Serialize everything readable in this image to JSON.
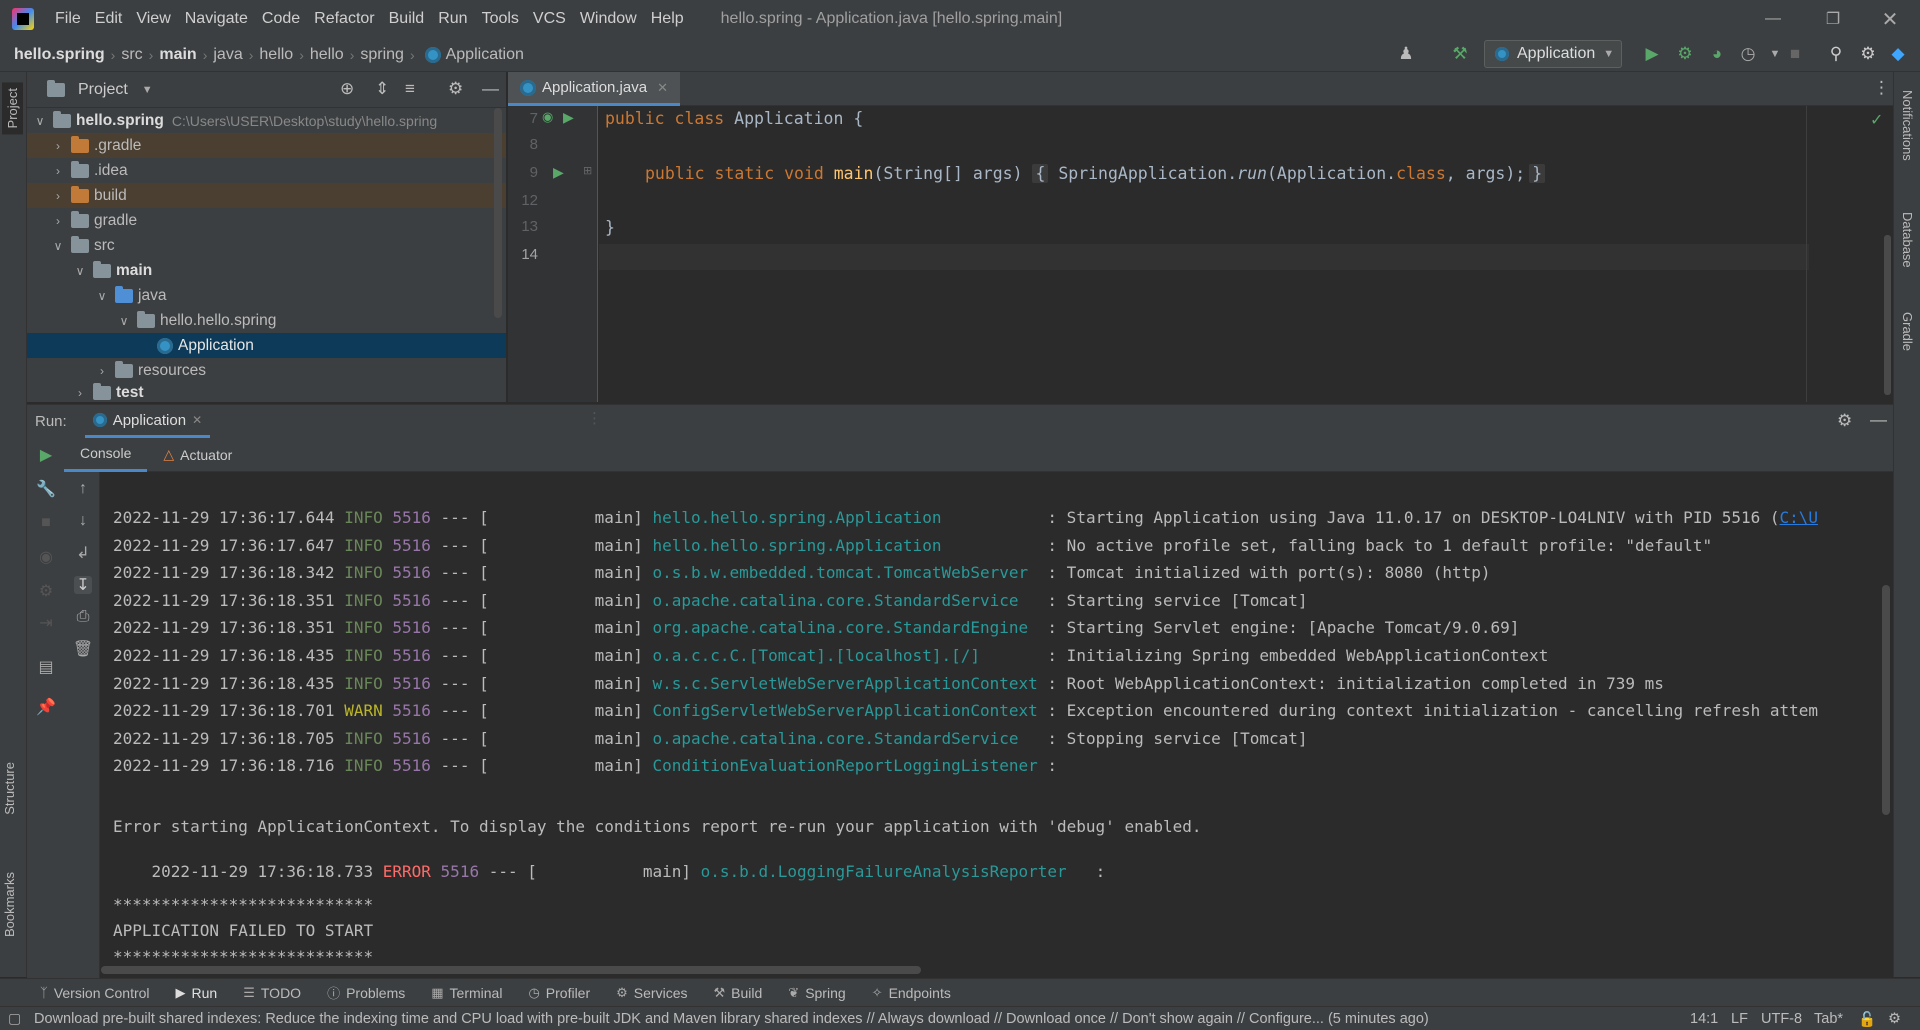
{
  "menubar": {
    "items": [
      "File",
      "Edit",
      "View",
      "Navigate",
      "Code",
      "Refactor",
      "Build",
      "Run",
      "Tools",
      "VCS",
      "Window",
      "Help"
    ],
    "title": "hello.spring - Application.java [hello.spring.main]"
  },
  "breadcrumb": [
    "hello.spring",
    "src",
    "main",
    "java",
    "hello",
    "hello",
    "spring",
    "Application"
  ],
  "toolbar": {
    "run_config": "Application"
  },
  "project": {
    "title": "Project",
    "root_label": "hello.spring",
    "root_path": "C:\\Users\\USER\\Desktop\\study\\hello.spring",
    "items": [
      ".gradle",
      ".idea",
      "build",
      "gradle",
      "src",
      "main",
      "java",
      "hello.hello.spring",
      "Application",
      "resources",
      "test"
    ]
  },
  "editor": {
    "tab": "Application.java",
    "line_numbers": [
      "7",
      "8",
      "9",
      "12",
      "13",
      "14"
    ],
    "lines": {
      "l7_kw": "public class ",
      "l7_name": "Application {",
      "l9_kw1": "public static void ",
      "l9_fn": "main",
      "l9_args": "(String[] args) ",
      "l9_fold_open": "{",
      "l9_body1": " SpringApplication.",
      "l9_run": "run",
      "l9_body2": "(Application.",
      "l9_class": "class",
      "l9_body3": ", args);",
      "l9_fold_close": "}",
      "l13": "}"
    }
  },
  "run": {
    "label": "Run:",
    "tab": "Application",
    "subtabs": [
      "Console",
      "Actuator"
    ]
  },
  "console": {
    "logs": [
      {
        "ts": "2022-11-29 17:36:17.644",
        "level": "INFO",
        "pid": "5516",
        "thread": "--- [           main] ",
        "logger": "hello.hello.spring.Application          ",
        "msg": " : Starting Application using Java 11.0.17 on DESKTOP-LO4LNIV with PID 5516 (",
        "link": "C:\\U"
      },
      {
        "ts": "2022-11-29 17:36:17.647",
        "level": "INFO",
        "pid": "5516",
        "thread": "--- [           main] ",
        "logger": "hello.hello.spring.Application          ",
        "msg": " : No active profile set, falling back to 1 default profile: \"default\""
      },
      {
        "ts": "2022-11-29 17:36:18.342",
        "level": "INFO",
        "pid": "5516",
        "thread": "--- [           main] ",
        "logger": "o.s.b.w.embedded.tomcat.TomcatWebServer ",
        "msg": " : Tomcat initialized with port(s): 8080 (http)"
      },
      {
        "ts": "2022-11-29 17:36:18.351",
        "level": "INFO",
        "pid": "5516",
        "thread": "--- [           main] ",
        "logger": "o.apache.catalina.core.StandardService  ",
        "msg": " : Starting service [Tomcat]"
      },
      {
        "ts": "2022-11-29 17:36:18.351",
        "level": "INFO",
        "pid": "5516",
        "thread": "--- [           main] ",
        "logger": "org.apache.catalina.core.StandardEngine ",
        "msg": " : Starting Servlet engine: [Apache Tomcat/9.0.69]"
      },
      {
        "ts": "2022-11-29 17:36:18.435",
        "level": "INFO",
        "pid": "5516",
        "thread": "--- [           main] ",
        "logger": "o.a.c.c.C.[Tomcat].[localhost].[/]      ",
        "msg": " : Initializing Spring embedded WebApplicationContext"
      },
      {
        "ts": "2022-11-29 17:36:18.435",
        "level": "INFO",
        "pid": "5516",
        "thread": "--- [           main] ",
        "logger": "w.s.c.ServletWebServerApplicationContext",
        "msg": " : Root WebApplicationContext: initialization completed in 739 ms"
      },
      {
        "ts": "2022-11-29 17:36:18.701",
        "level": "WARN",
        "pid": "5516",
        "thread": "--- [           main] ",
        "logger": "ConfigServletWebServerApplicationContext",
        "msg": " : Exception encountered during context initialization - cancelling refresh attem"
      },
      {
        "ts": "2022-11-29 17:36:18.705",
        "level": "INFO",
        "pid": "5516",
        "thread": "--- [           main] ",
        "logger": "o.apache.catalina.core.StandardService  ",
        "msg": " : Stopping service [Tomcat]"
      },
      {
        "ts": "2022-11-29 17:36:18.716",
        "level": "INFO",
        "pid": "5516",
        "thread": "--- [           main] ",
        "logger": "ConditionEvaluationReportLoggingListener",
        "msg": " :"
      }
    ],
    "error_context": "Error starting ApplicationContext. To display the conditions report re-run your application with 'debug' enabled.",
    "error_log": {
      "ts": "2022-11-29 17:36:18.733",
      "level": "ERROR",
      "pid": "5516",
      "thread": "--- [           main] ",
      "logger": "o.s.b.d.LoggingFailureAnalysisReporter  ",
      "msg": " :"
    },
    "stars": "***************************",
    "failed": "APPLICATION FAILED TO START",
    "stars2": "***************************"
  },
  "left_strip": {
    "project": "Project",
    "structure": "Structure",
    "bookmarks": "Bookmarks"
  },
  "right_strip": {
    "notifications": "Notifications",
    "database": "Database",
    "gradle": "Gradle"
  },
  "bottom_tabs": [
    "Version Control",
    "Run",
    "TODO",
    "Problems",
    "Terminal",
    "Profiler",
    "Services",
    "Build",
    "Spring",
    "Endpoints"
  ],
  "status": {
    "message": "Download pre-built shared indexes: Reduce the indexing time and CPU load with pre-built JDK and Maven library shared indexes // Always download // Download once // Don't show again // Configure... (5 minutes ago)",
    "position": "14:1",
    "line_sep": "LF",
    "encoding": "UTF-8",
    "indent": "Tab*"
  },
  "colors": {
    "accent": "#4a88c7",
    "info": "#6a8759",
    "warn": "#bbb529",
    "error": "#ff6b68",
    "logger": "#299999",
    "keyword": "#cc7832"
  }
}
